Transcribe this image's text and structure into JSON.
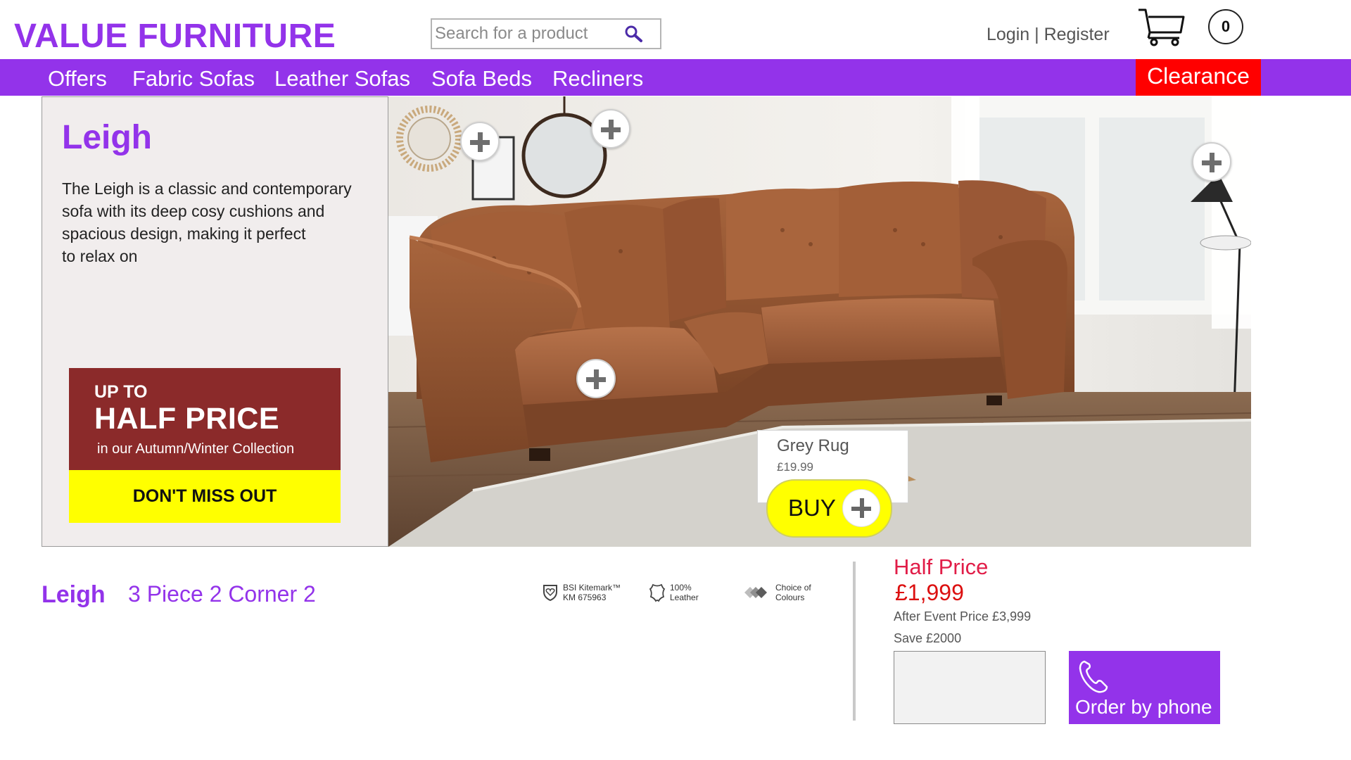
{
  "header": {
    "logo": "VALUE FURNITURE",
    "search_placeholder": "Search for a product",
    "login_label": "Login",
    "separator": " | ",
    "register_label": "Register",
    "cart_count": "0"
  },
  "nav": {
    "items": [
      "Offers",
      "Fabric Sofas",
      "Leather Sofas",
      "Sofa Beds",
      "Recliners"
    ],
    "clearance_label": "Clearance"
  },
  "hero": {
    "title": "Leigh",
    "description": "The Leigh is a classic and contemporary\n sofa with its deep cosy cushions and\nspacious design, making it perfect\nto relax on",
    "promo": {
      "up_to": "UP TO",
      "headline": "HALF PRICE",
      "subtext": "in our Autumn/Winter Collection",
      "cta": "DON'T MISS OUT"
    },
    "hotspot_card": {
      "name": "Grey Rug",
      "price": "£19.99",
      "buy_label": "BUY"
    }
  },
  "product": {
    "name": "Leigh",
    "variant": "3 Piece 2 Corner 2",
    "badges": [
      {
        "icon": "shield-heart-icon",
        "text": "BSI Kitemark™\nKM 675963"
      },
      {
        "icon": "leather-hide-icon",
        "text": "100%\nLeather"
      },
      {
        "icon": "colour-swatch-icon",
        "text": "Choice of\nColours"
      }
    ],
    "deal_label": "Half Price",
    "price": "£1,999",
    "after_event_price": "After Event Price £3,999",
    "saving": "Save £2000",
    "order_by_phone_label": "Order by phone"
  },
  "colors": {
    "brand_purple": "#9333ea",
    "clearance_red": "#ff0000",
    "promo_maroon": "#8b2a2a",
    "promo_yellow": "#ffff00",
    "price_red": "#dc1010"
  }
}
